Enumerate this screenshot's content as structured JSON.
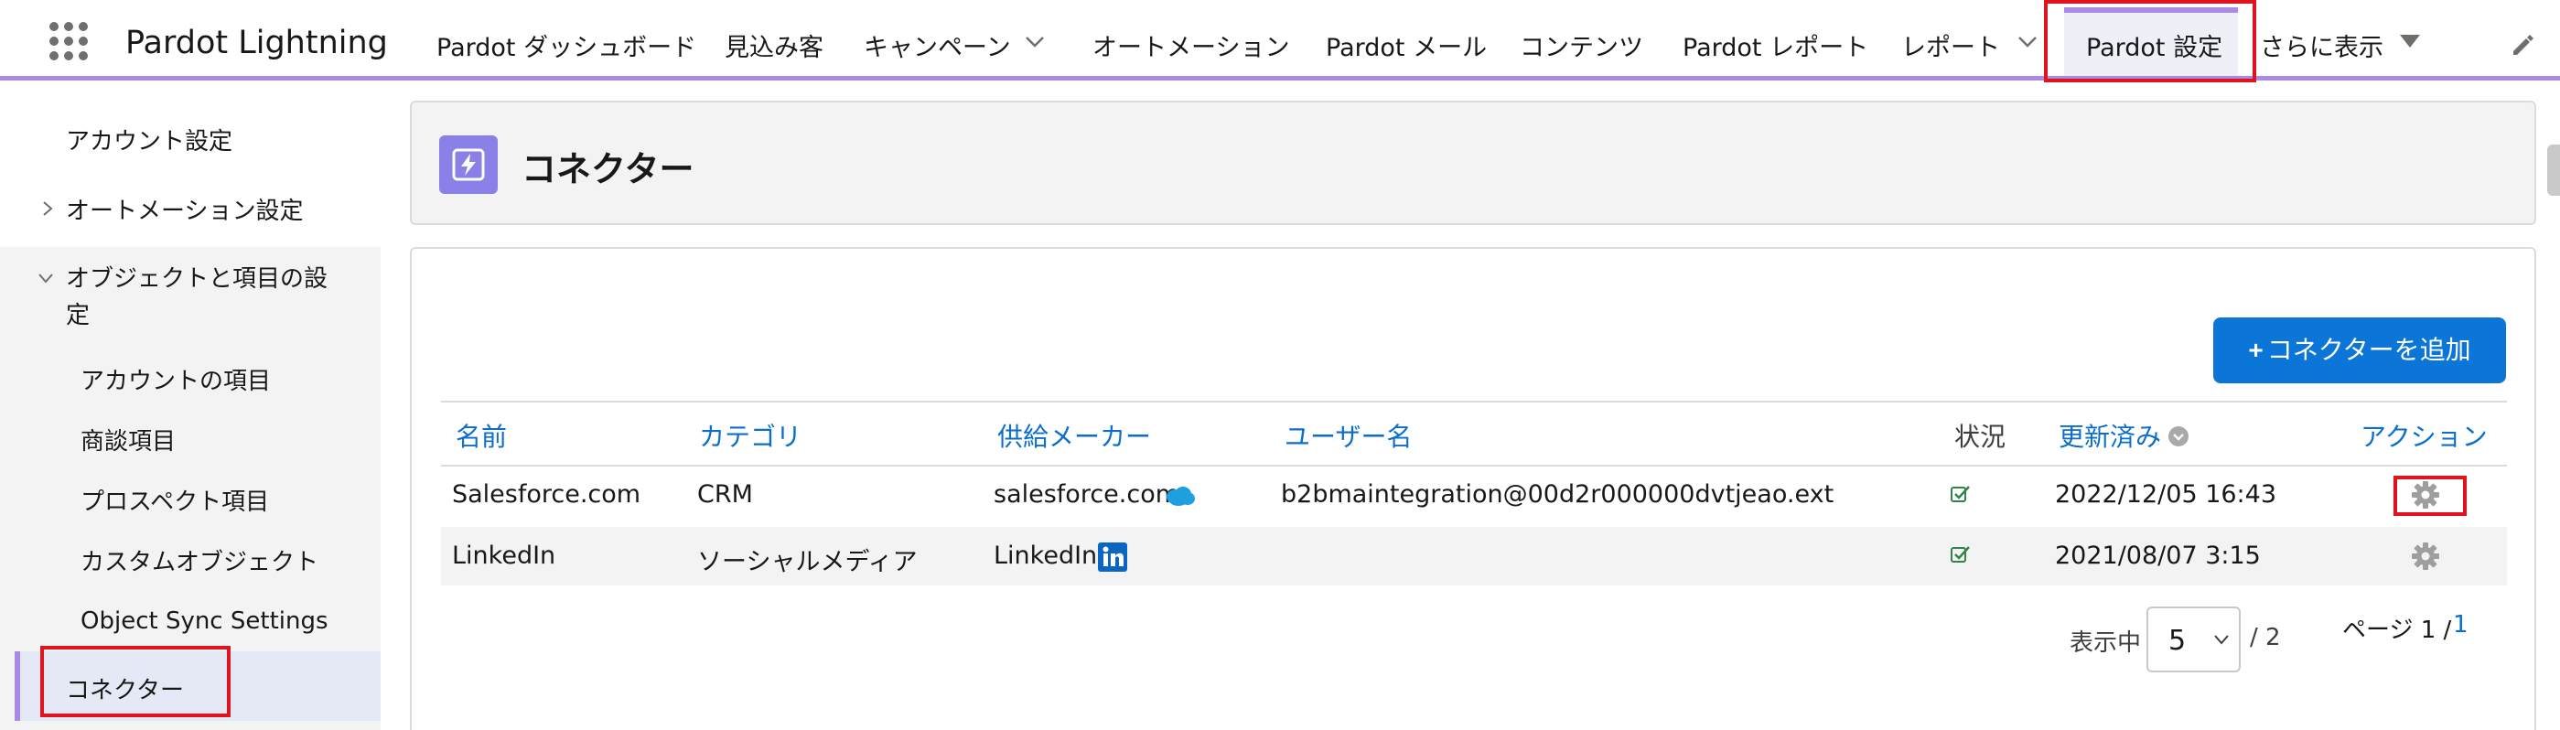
{
  "app": {
    "name": "Pardot Lightning"
  },
  "nav": {
    "items": [
      {
        "label": "Pardot ダッシュボード"
      },
      {
        "label": "見込み客"
      },
      {
        "label": "キャンペーン"
      },
      {
        "label": "オートメーション"
      },
      {
        "label": "Pardot メール"
      },
      {
        "label": "コンテンツ"
      },
      {
        "label": "Pardot レポート"
      },
      {
        "label": "レポート"
      },
      {
        "label": "Pardot 設定"
      },
      {
        "label": "さらに表示"
      }
    ],
    "active": "Pardot 設定"
  },
  "sidebar": {
    "items": [
      {
        "label": "アカウント設定"
      },
      {
        "label": "オートメーション設定"
      },
      {
        "label": "オブジェクトと項目の設"
      },
      {
        "label": "定"
      },
      {
        "label": "アカウントの項目"
      },
      {
        "label": "商談項目"
      },
      {
        "label": "プロスペクト項目"
      },
      {
        "label": "カスタムオブジェクト"
      },
      {
        "label": "Object Sync Settings"
      },
      {
        "label": "コネクター"
      }
    ],
    "active": "コネクター"
  },
  "page": {
    "title": "コネクター",
    "add_button": {
      "plus": "+",
      "label": "コネクターを追加"
    }
  },
  "table": {
    "headers": [
      "名前",
      "カテゴリ",
      "供給メーカー",
      "ユーザー名",
      "状況",
      "更新済み",
      "アクション"
    ],
    "rows": [
      {
        "name": "Salesforce.com",
        "category": "CRM",
        "vendor": "salesforce.com",
        "vendor_icon": "salesforce-cloud-icon",
        "username": "b2bmaintegration@00d2r000000dvtjeao.ext",
        "status_icon": "check-icon",
        "updated": "2022/12/05 16:43",
        "action_icon": "gear-icon"
      },
      {
        "name": "LinkedIn",
        "category": "ソーシャルメディア",
        "vendor": "LinkedIn",
        "vendor_icon": "linkedin-icon",
        "username": "",
        "status_icon": "check-icon",
        "updated": "2021/08/07 3:15",
        "action_icon": "gear-icon"
      }
    ]
  },
  "pagination": {
    "showing_label": "表示中",
    "page_size": "5",
    "total": "/ 2",
    "page_label": "ページ 1 /",
    "page_link": "1"
  },
  "colors": {
    "accent": "#a98ae6",
    "brand_blue": "#0b76d8",
    "link": "#0b6ecc",
    "status_green": "#2e844a",
    "highlight_red": "#e0141e",
    "salesforce_blue": "#1ea0e0",
    "linkedin_blue": "#0a66c2"
  }
}
